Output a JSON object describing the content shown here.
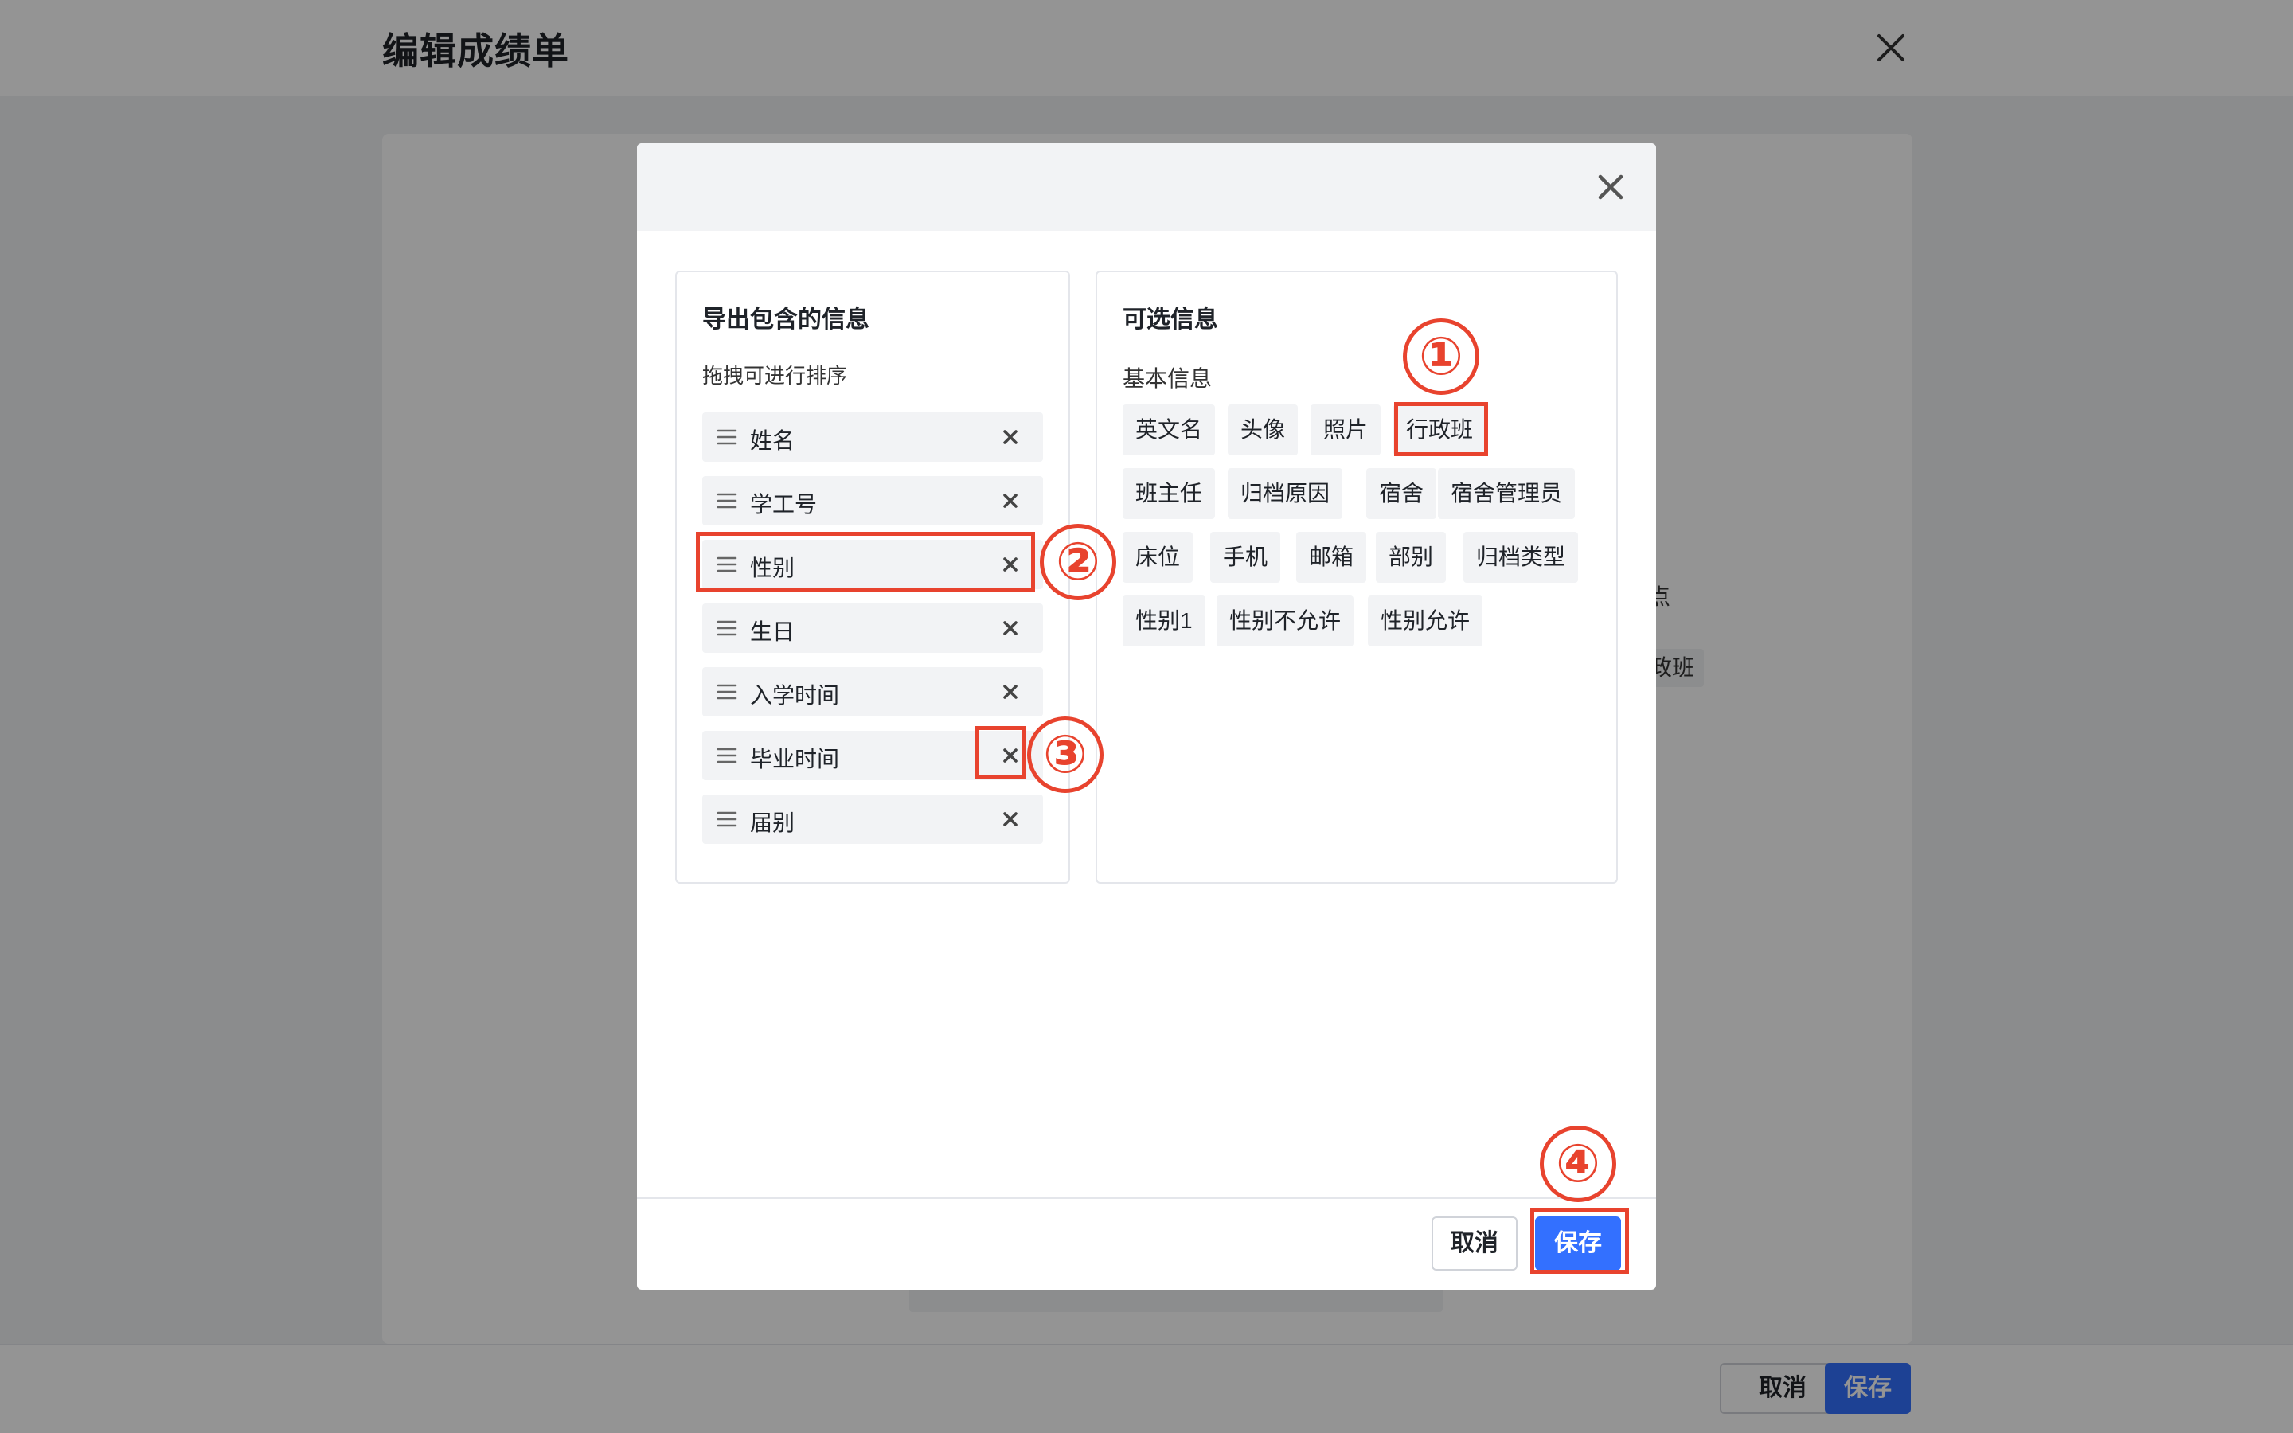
{
  "page": {
    "title": "编辑成绩单",
    "bg_fragment_1": "点",
    "bg_fragment_2": "政班",
    "footer": {
      "cancel_label": "取消",
      "save_label": "保存"
    }
  },
  "modal": {
    "left_panel": {
      "title": "导出包含的信息",
      "subtitle": "拖拽可进行排序",
      "fields": [
        "姓名",
        "学工号",
        "性别",
        "生日",
        "入学时间",
        "毕业时间",
        "届别"
      ]
    },
    "right_panel": {
      "title": "可选信息",
      "group_label": "基本信息",
      "tags": [
        "英文名",
        "头像",
        "照片",
        "行政班",
        "班主任",
        "归档原因",
        "宿舍",
        "宿舍管理员",
        "床位",
        "手机",
        "邮箱",
        "部别",
        "归档类型",
        "性别1",
        "性别不允许",
        "性别允许"
      ]
    },
    "footer": {
      "cancel_label": "取消",
      "save_label": "保存"
    }
  },
  "annotations": [
    "①",
    "②",
    "③",
    "④"
  ],
  "colors": {
    "primary": "#3370ff",
    "annotation": "#e8432e",
    "tag_bg": "#f2f3f5"
  }
}
